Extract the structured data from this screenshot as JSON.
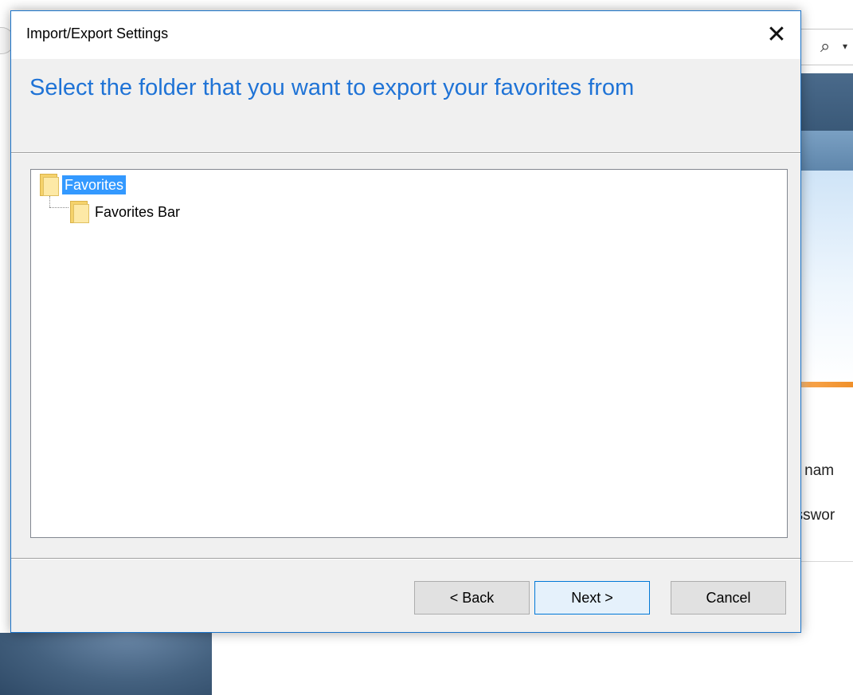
{
  "dialog": {
    "title": "Import/Export Settings",
    "close_glyph": "✕",
    "heading": "Select the folder that you want to export your favorites from",
    "tree": {
      "nodes": [
        {
          "label": "Favorites",
          "selected": true
        },
        {
          "label": "Favorites Bar",
          "selected": false
        }
      ]
    },
    "buttons": {
      "back": "< Back",
      "next": "Next >",
      "cancel": "Cancel"
    }
  },
  "background": {
    "search_icon": "⌕",
    "search_dropdown": "▾",
    "label_username": "er nam",
    "label_password": "asswor"
  },
  "colors": {
    "heading": "#1f73d6",
    "selection": "#3399ff",
    "dialog_border": "#1a73c9",
    "accent_orange": "#f0902a"
  }
}
